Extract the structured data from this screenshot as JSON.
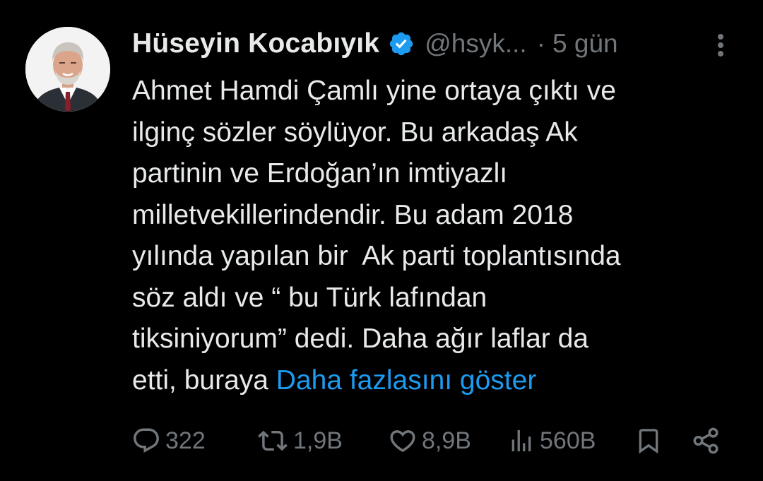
{
  "author": {
    "display_name": "Hüseyin Kocabıyık",
    "handle": "@hsyk...",
    "separator": "·",
    "time": "5 gün",
    "verified": true
  },
  "tweet": {
    "lines": [
      "Ahmet Hamdi Çamlı yine ortaya çıktı ve",
      "ilginç sözler söylüyor. Bu arkadaş Ak",
      "partinin ve Erdoğan’ın imtiyazlı",
      "milletvekillerindendir. Bu adam 2018",
      "yılında yapılan bir  Ak parti toplantısında",
      "söz aldı ve “ bu Türk lafından",
      "tiksiniyorum” dedi. Daha ağır laflar da",
      "etti, buraya "
    ],
    "show_more": "Daha fazlasını göster"
  },
  "actions": {
    "replies": "322",
    "reposts": "1,9B",
    "likes": "8,9B",
    "views": "560B"
  },
  "icons": {
    "verified": "verified-badge-icon",
    "more": "more-vertical-icon",
    "reply": "reply-icon",
    "repost": "repost-icon",
    "like": "heart-icon",
    "views": "views-icon",
    "bookmark": "bookmark-icon",
    "share": "share-icon"
  },
  "colors": {
    "background": "#000000",
    "text": "#e7e9ea",
    "muted": "#71767b",
    "link": "#1d9bf0",
    "verified": "#1d9bf0"
  }
}
